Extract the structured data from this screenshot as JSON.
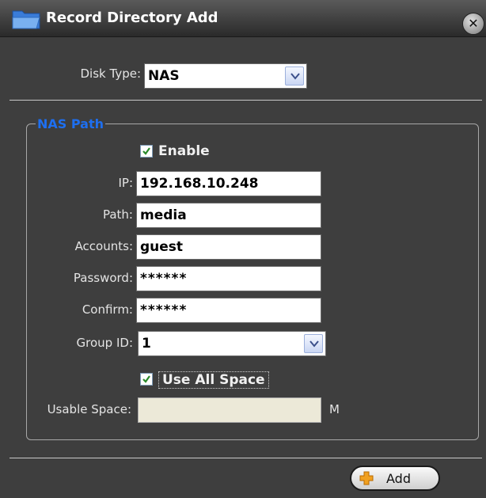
{
  "window": {
    "title": "Record Directory Add",
    "close_glyph": "✕"
  },
  "disk_type": {
    "label": "Disk Type:",
    "value": "NAS"
  },
  "nas_path": {
    "legend": "NAS Path",
    "enable_label": "Enable",
    "enable_checked": true,
    "ip_label": "IP:",
    "ip_value": "192.168.10.248",
    "path_label": "Path:",
    "path_value": "media",
    "accounts_label": "Accounts:",
    "accounts_value": "guest",
    "password_label": "Password:",
    "password_value": "******",
    "confirm_label": "Confirm:",
    "confirm_value": "******",
    "group_id_label": "Group ID:",
    "group_id_value": "1",
    "use_all_space_label": "Use All Space",
    "use_all_space_checked": true,
    "usable_space_label": "Usable Space:",
    "usable_space_value": "",
    "usable_space_unit": "M"
  },
  "footer": {
    "add_label": "Add"
  },
  "colors": {
    "legend": "#1e6ff0",
    "check": "#2a8a2a",
    "add_icon": "#f0a020",
    "background": "#3e3e3e"
  }
}
